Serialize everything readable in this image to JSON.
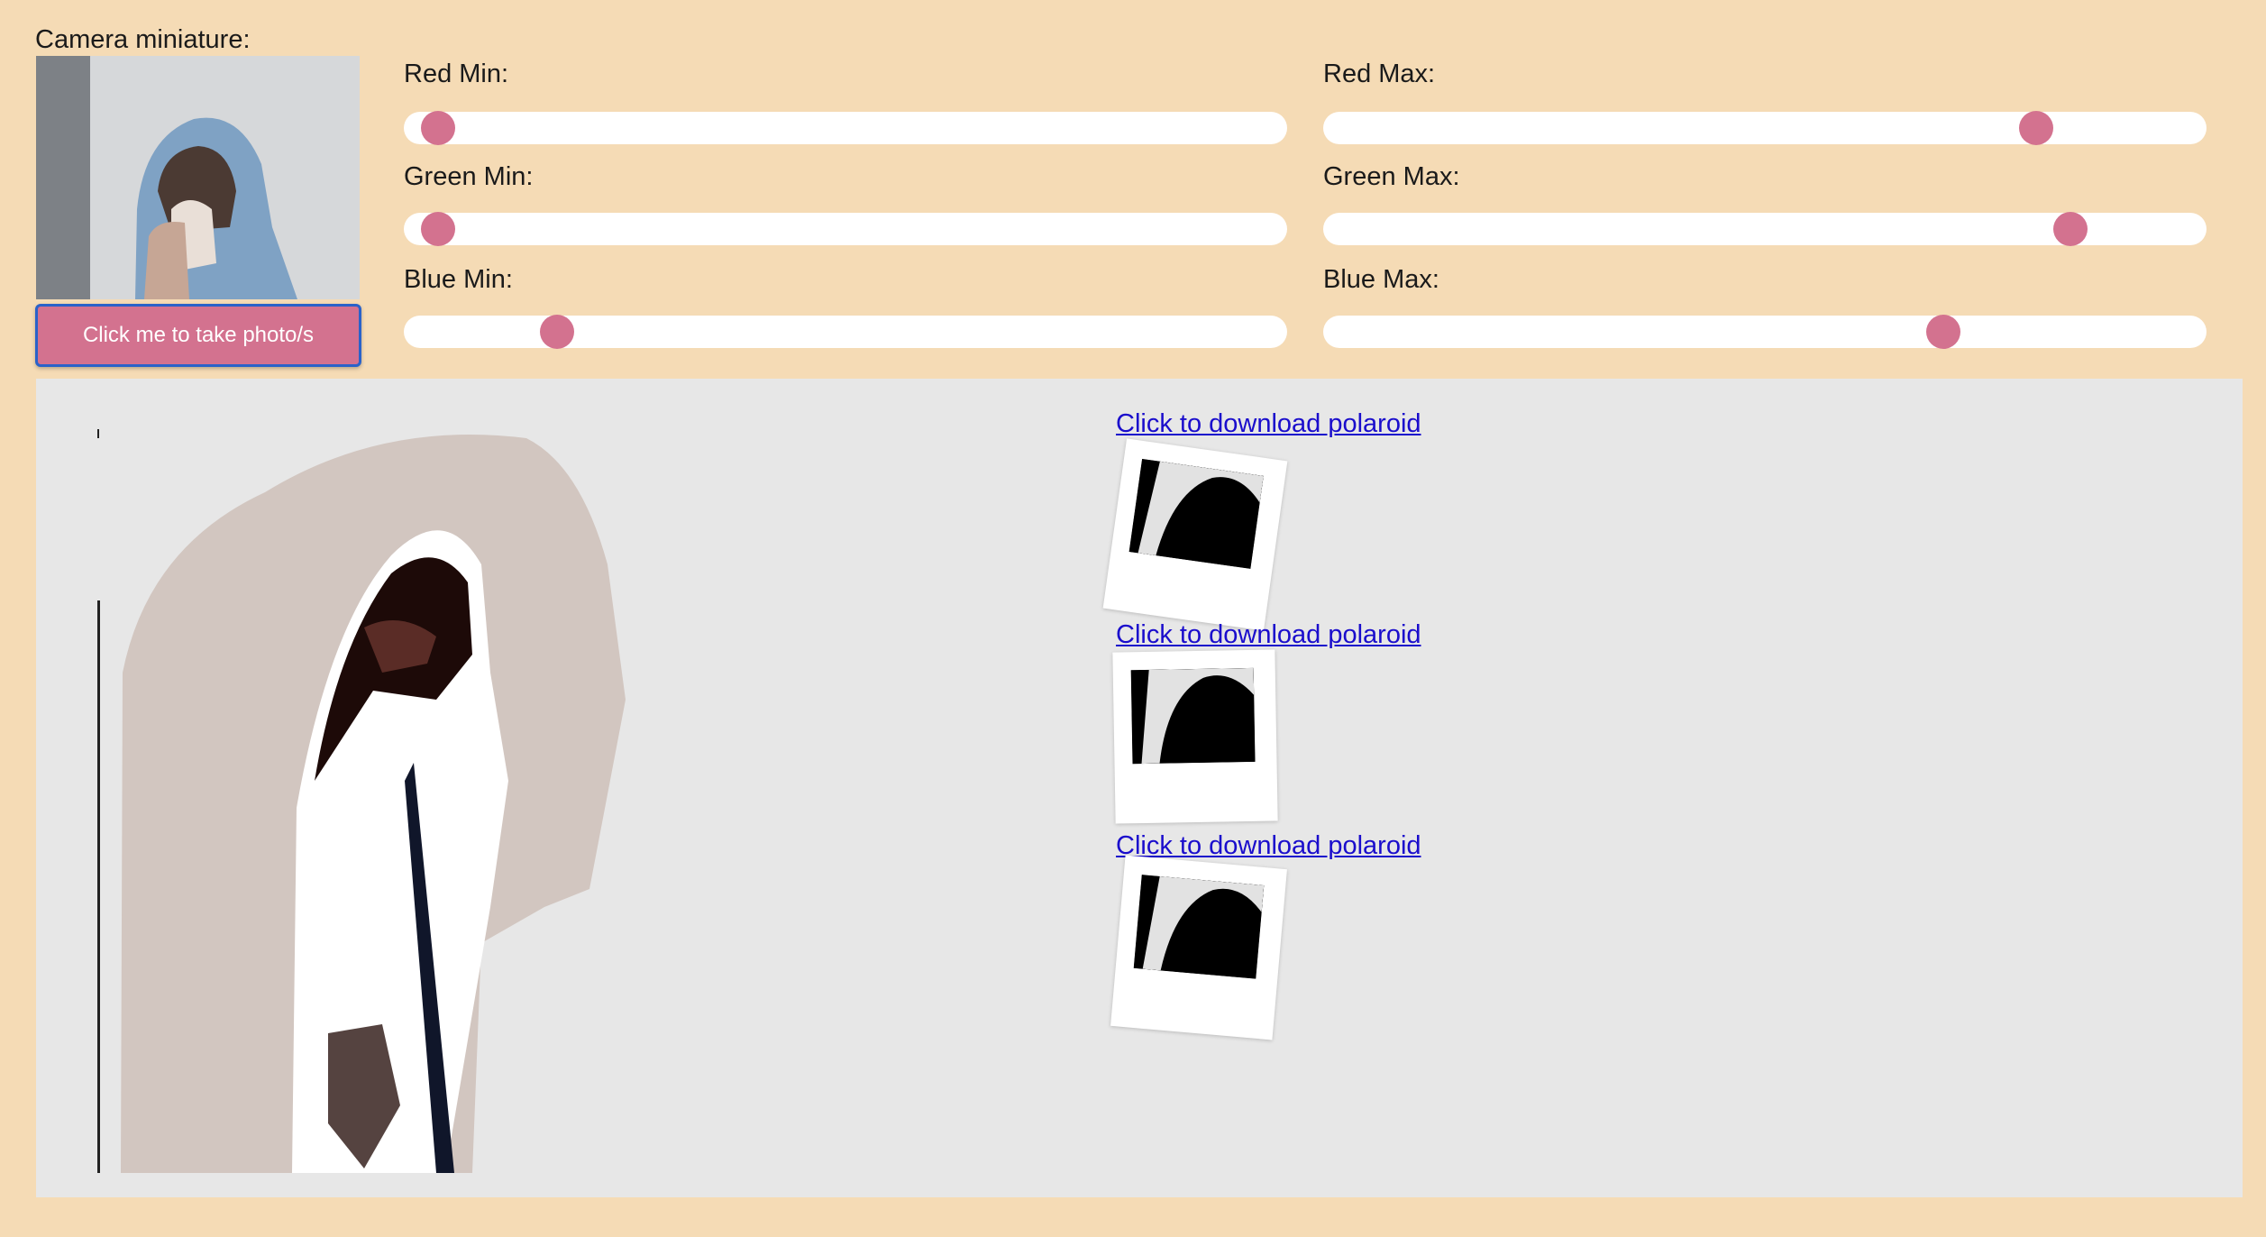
{
  "camera": {
    "label": "Camera miniature:",
    "take_photo_label": "Click me to take photo/s"
  },
  "sliders": [
    {
      "label": "Red Min:",
      "value": 0.02
    },
    {
      "label": "Red Max:",
      "value": 0.82
    },
    {
      "label": "Green Min:",
      "value": 0.02
    },
    {
      "label": "Green Max:",
      "value": 0.86
    },
    {
      "label": "Blue Min:",
      "value": 0.16
    },
    {
      "label": "Blue Max:",
      "value": 0.71
    }
  ],
  "polaroids": [
    {
      "link": "Click to download polaroid"
    },
    {
      "link": "Click to download polaroid"
    },
    {
      "link": "Click to download polaroid"
    }
  ],
  "colors": {
    "background": "#f5dbb5",
    "accent": "#d3728f",
    "canvas": "#e7e7e7",
    "link": "#1a0dcc"
  }
}
